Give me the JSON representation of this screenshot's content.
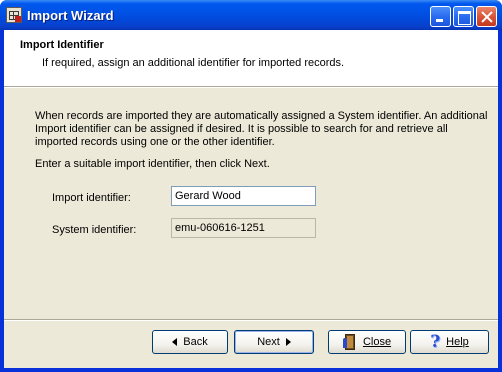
{
  "window": {
    "title": "Import Wizard",
    "accent": "#0054e3"
  },
  "header": {
    "title": "Import Identifier",
    "subtitle": "If required, assign an additional identifier for imported records."
  },
  "body": {
    "description": "When records are imported they are automatically assigned a System identifier. An additional Import identifier can be assigned if desired. It is possible to search for and retrieve all imported records using one or the other identifier.",
    "instruction": "Enter a suitable import identifier, then click Next."
  },
  "fields": {
    "import_label": "Import identifier:",
    "import_value": "Gerard Wood",
    "system_label": "System identifier:",
    "system_value": "emu-060616-1251"
  },
  "buttons": {
    "back": "Back",
    "next": "Next",
    "close": "Close",
    "help": "Help"
  }
}
